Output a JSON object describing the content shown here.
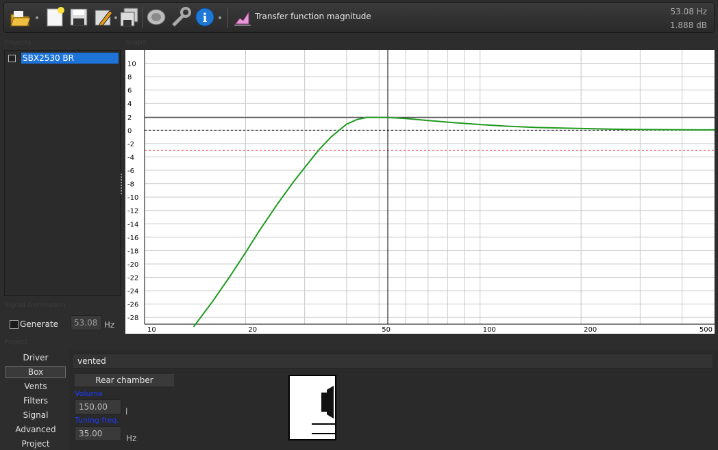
{
  "toolbar": {
    "buttons": [
      {
        "name": "open-folder-icon"
      },
      {
        "name": "new-document-icon"
      },
      {
        "name": "save-disk-icon"
      },
      {
        "name": "edit-pencil-icon"
      },
      {
        "name": "save-all-icon"
      },
      {
        "name": "speaker-icon"
      },
      {
        "name": "wrench-icon"
      },
      {
        "name": "info-icon"
      },
      {
        "name": "graph-type-icon"
      }
    ],
    "graph_title": "Transfer function magnitude",
    "readout_freq": "53.08 Hz",
    "readout_db": "1.888 dB"
  },
  "panels": {
    "projects_caption": "Projects",
    "graph_caption": "Graph",
    "signal_caption": "Signal Generation",
    "project_caption": "Project"
  },
  "projects": {
    "items": [
      "SBX2530 BR"
    ]
  },
  "generator": {
    "label": "Generate",
    "value": "53.08",
    "unit": "Hz"
  },
  "nav": {
    "items": [
      "Driver",
      "Box",
      "Vents",
      "Filters",
      "Signal",
      "Advanced",
      "Project"
    ],
    "active": "Box"
  },
  "box": {
    "type": "vented",
    "rear_chamber": "Rear chamber",
    "volume_label": "Volume",
    "volume_value": "150.00",
    "volume_unit": "l",
    "tuning_label": "Tuning freq.",
    "tuning_value": "35.00",
    "tuning_unit": "Hz"
  },
  "chart_data": {
    "type": "line",
    "title": "Transfer function magnitude",
    "xlabel": "",
    "ylabel": "",
    "xscale": "log",
    "xlim": [
      10,
      500
    ],
    "ylim": [
      -29,
      12
    ],
    "x_ticks": [
      10,
      20,
      50,
      100,
      200,
      500
    ],
    "y_ticks": [
      10,
      8,
      6,
      4,
      2,
      0,
      -2,
      -4,
      -6,
      -8,
      -10,
      -12,
      -14,
      -16,
      -18,
      -20,
      -22,
      -24,
      -26,
      -28
    ],
    "grid": true,
    "cursor": {
      "x": 53.08,
      "y": 1.888
    },
    "reference_lines": [
      {
        "y": 0,
        "style": "dashed",
        "color": "#000000"
      },
      {
        "y": -3,
        "style": "dashed",
        "color": "#d01010"
      }
    ],
    "series": [
      {
        "color": "#1f9a1f",
        "x": [
          14,
          16,
          18,
          20,
          22,
          25,
          28,
          30,
          33,
          36,
          40,
          43,
          46,
          50,
          53.08,
          60,
          70,
          80,
          100,
          120,
          150,
          200,
          250,
          300,
          400,
          500
        ],
        "y": [
          -29.4,
          -25.5,
          -21.8,
          -18.3,
          -15,
          -10.9,
          -7.5,
          -5.6,
          -3,
          -1,
          0.9,
          1.6,
          1.9,
          1.9,
          1.888,
          1.75,
          1.45,
          1.2,
          0.85,
          0.6,
          0.4,
          0.25,
          0.15,
          0.1,
          0.06,
          0.05
        ]
      }
    ]
  }
}
